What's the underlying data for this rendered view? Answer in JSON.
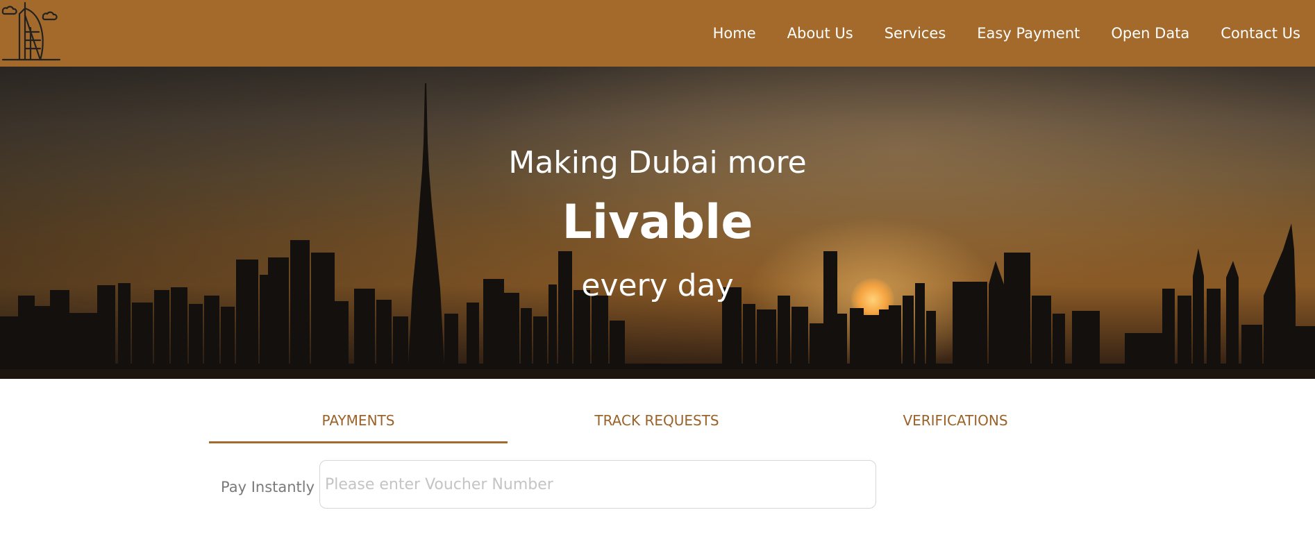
{
  "nav": {
    "links": [
      "Home",
      "About Us",
      "Services",
      "Easy Payment",
      "Open Data",
      "Contact Us"
    ]
  },
  "logo": {
    "icon": "burj-al-arab-icon"
  },
  "hero": {
    "line1": "Making Dubai more",
    "line2": "Livable",
    "line3": "every day"
  },
  "tabs": [
    {
      "label": "PAYMENTS",
      "active": true
    },
    {
      "label": "TRACK REQUESTS",
      "active": false
    },
    {
      "label": "VERIFICATIONS",
      "active": false
    }
  ],
  "payment": {
    "label": "Pay Instantly",
    "placeholder": "Please enter Voucher Number",
    "value": ""
  },
  "colors": {
    "brand": "#a46a2c",
    "tab_text": "#9a6229"
  }
}
